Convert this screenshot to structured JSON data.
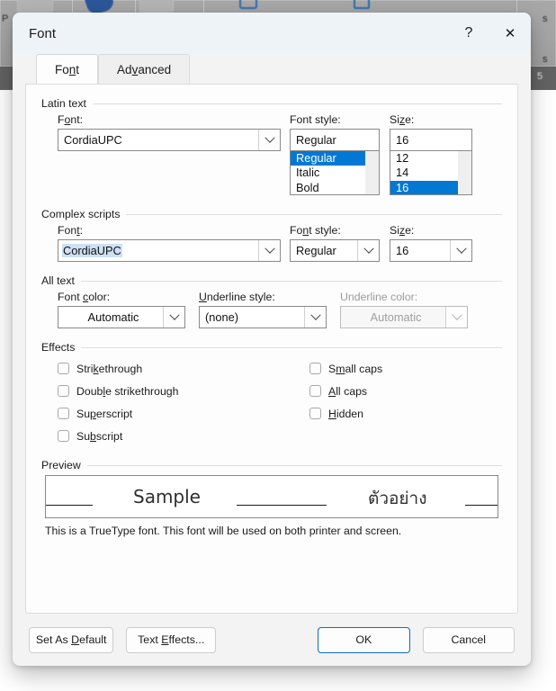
{
  "background": {
    "ribbon_labels": [
      "P",
      "s",
      "s",
      "5"
    ],
    "note": "blurred Microsoft Word ribbon behind modal"
  },
  "dialog": {
    "title": "Font",
    "help_button": "?",
    "close_button": "✕",
    "tabs": [
      {
        "label": "Font",
        "accel": "n",
        "active": true
      },
      {
        "label": "Advanced",
        "accel": "v",
        "active": false
      }
    ],
    "groups": {
      "latin_text": {
        "title": "Latin text",
        "font": {
          "label": "Font:",
          "accel": "F",
          "value": "CordiaUPC"
        },
        "font_style": {
          "label": "Font style:",
          "accel": "n",
          "value": "Regular",
          "options": [
            "Regular",
            "Italic",
            "Bold"
          ],
          "selected": "Regular"
        },
        "size": {
          "label": "Size:",
          "accel": "z",
          "value": "16",
          "options": [
            "12",
            "14",
            "16"
          ],
          "selected": "16"
        }
      },
      "complex_scripts": {
        "title": "Complex scripts",
        "font": {
          "label": "Font:",
          "accel": "t",
          "value": "CordiaUPC",
          "text_selected": true
        },
        "font_style": {
          "label": "Font style:",
          "accel": "n",
          "value": "Regular"
        },
        "size": {
          "label": "Size:",
          "accel": "z",
          "value": "16"
        }
      },
      "all_text": {
        "title": "All text",
        "font_color": {
          "label": "Font color:",
          "accel": "c",
          "value": "Automatic",
          "disabled": false
        },
        "underline_style": {
          "label": "Underline style:",
          "accel": "U",
          "value": "(none)",
          "disabled": false
        },
        "underline_color": {
          "label": "Underline color:",
          "value": "Automatic",
          "disabled": true
        }
      },
      "effects": {
        "title": "Effects",
        "left_column": [
          {
            "label": "Strikethrough",
            "checked": false
          },
          {
            "label": "Double strikethrough",
            "checked": false
          },
          {
            "label": "Superscript",
            "checked": false
          },
          {
            "label": "Subscript",
            "checked": false
          }
        ],
        "right_column": [
          {
            "label": "Small caps",
            "checked": false
          },
          {
            "label": "All caps",
            "checked": false
          },
          {
            "label": "Hidden",
            "checked": false
          }
        ]
      },
      "preview": {
        "title": "Preview",
        "latin_sample": "Sample",
        "complex_sample": "ตัวอย่าง",
        "note": "This is a TrueType font. This font will be used on both printer and screen."
      }
    },
    "footer": {
      "set_as_default": "Set As Default",
      "text_effects": "Text Effects...",
      "ok": "OK",
      "cancel": "Cancel"
    }
  },
  "colors": {
    "accent": "#0078d4",
    "default_button_border": "#0f6cbd",
    "titlebar": "#eef3f8",
    "dialog_bg": "#f3f3f3",
    "selection_highlight": "#cde0f4"
  }
}
